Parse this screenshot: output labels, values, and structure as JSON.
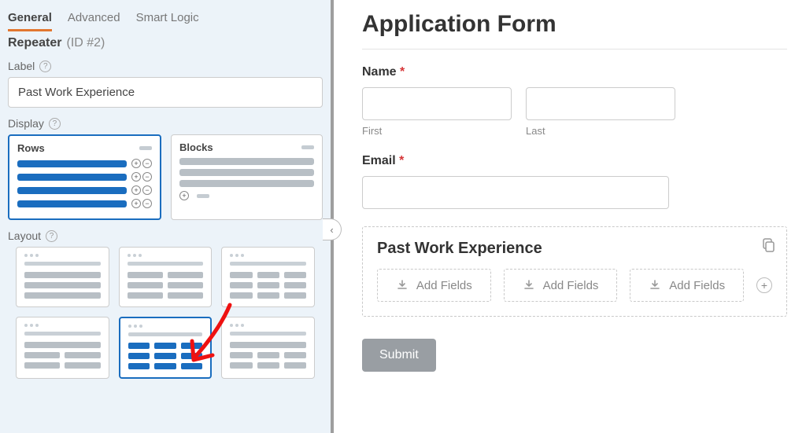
{
  "tabs": {
    "general": "General",
    "advanced": "Advanced",
    "smart": "Smart Logic"
  },
  "section": {
    "name": "Repeater",
    "id": "(ID #2)"
  },
  "labels": {
    "label": "Label",
    "display": "Display",
    "layout": "Layout"
  },
  "label_value": "Past Work Experience",
  "display": {
    "rows": "Rows",
    "blocks": "Blocks"
  },
  "help": "?",
  "collapse": "‹",
  "form": {
    "title": "Application Form",
    "name_label": "Name",
    "email_label": "Email",
    "first": "First",
    "last": "Last",
    "required": "*",
    "repeater_title": "Past Work Experience",
    "add_fields": "Add Fields",
    "submit": "Submit"
  }
}
